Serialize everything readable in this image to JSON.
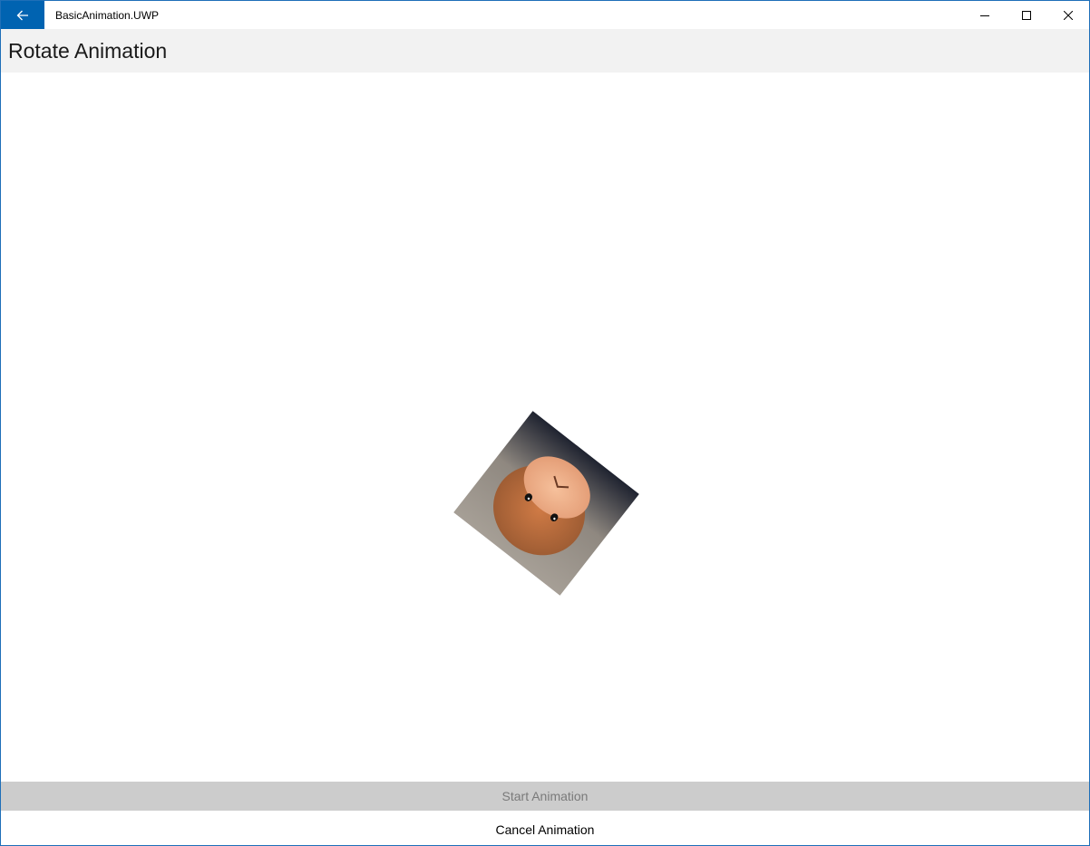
{
  "window": {
    "app_title": "BasicAnimation.UWP",
    "accent_color": "#0063b1"
  },
  "icons": {
    "back": "back-arrow-icon",
    "minimize": "minimize-icon",
    "maximize": "maximize-icon",
    "close": "close-icon"
  },
  "header": {
    "title": "Rotate Animation"
  },
  "content": {
    "image_subject": "plush monkey toy",
    "rotation_degrees": -142
  },
  "buttons": {
    "start_label": "Start Animation",
    "start_enabled": false,
    "cancel_label": "Cancel Animation",
    "cancel_enabled": true
  }
}
